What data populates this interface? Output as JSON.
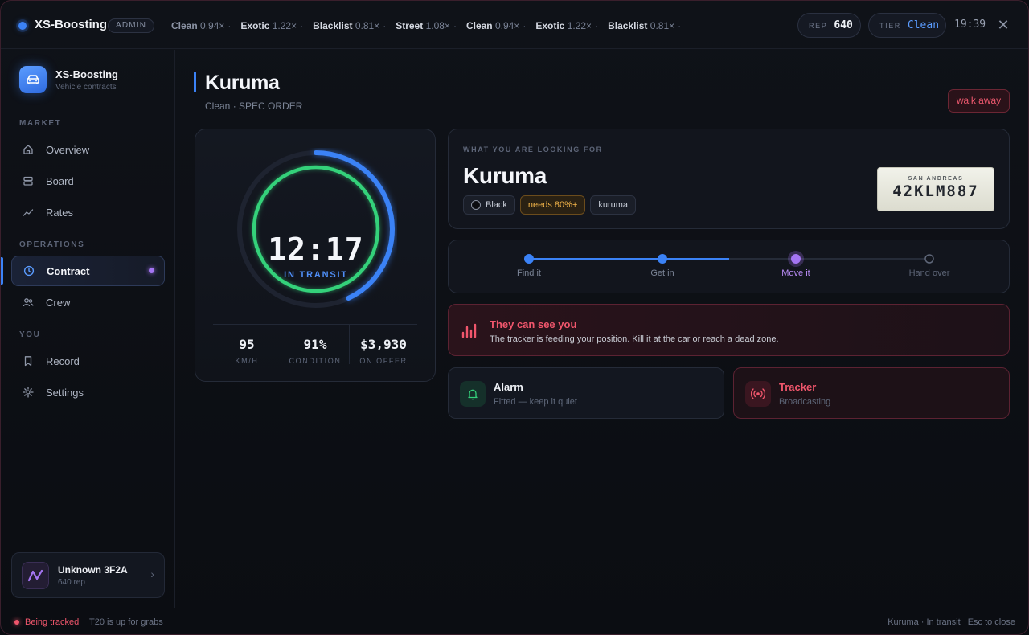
{
  "topbar": {
    "brand": "XS-Boosting",
    "badge": "ADMIN",
    "ticker": [
      {
        "name": "Clean",
        "value": "0.94×"
      },
      {
        "name": "Exotic",
        "value": "1.22×"
      },
      {
        "name": "Blacklist",
        "value": "0.81×"
      },
      {
        "name": "Street",
        "value": "1.08×"
      },
      {
        "name": "Clean",
        "value": "0.94×"
      },
      {
        "name": "Exotic",
        "value": "1.22×"
      },
      {
        "name": "Blacklist",
        "value": "0.81×"
      }
    ],
    "ticker_sep": "·",
    "rep_label": "REP",
    "rep_value": "640",
    "tier_label": "TIER",
    "tier_value": "Clean",
    "clock": "19:39",
    "close": "✕"
  },
  "sidebar": {
    "app_title": "XS-Boosting",
    "app_sub": "Vehicle contracts",
    "sections": {
      "market": "MARKET",
      "operations": "OPERATIONS",
      "you": "YOU"
    },
    "items": {
      "overview": "Overview",
      "board": "Board",
      "rates": "Rates",
      "contract": "Contract",
      "crew": "Crew",
      "record": "Record",
      "settings": "Settings"
    },
    "user": {
      "name": "Unknown 3F2A",
      "rep": "640 rep"
    }
  },
  "main": {
    "title": "Kuruma",
    "subtitle": "Clean · SPEC ORDER",
    "walk_away": "walk away",
    "timer": {
      "time": "12:17",
      "status": "IN TRANSIT",
      "outer_progress": 0.43,
      "inner_progress": 1.0
    },
    "stats": [
      {
        "value": "95",
        "label": "KM/H"
      },
      {
        "value": "91%",
        "label": "CONDITION"
      },
      {
        "value": "$3,930",
        "label": "ON OFFER"
      }
    ],
    "target": {
      "label": "WHAT YOU ARE LOOKING FOR",
      "name": "Kuruma",
      "color_chip": "Black",
      "condition_chip": "needs 80%+",
      "model_chip": "kuruma",
      "plate_state": "SAN ANDREAS",
      "plate_number": "42KLM887"
    },
    "steps": [
      {
        "label": "Find it",
        "state": "done"
      },
      {
        "label": "Get in",
        "state": "done"
      },
      {
        "label": "Move it",
        "state": "current"
      },
      {
        "label": "Hand over",
        "state": "todo"
      }
    ],
    "alert": {
      "title": "They can see you",
      "text": "The tracker is feeding your position. Kill it at the car or reach a dead zone."
    },
    "systems": {
      "alarm": {
        "name": "Alarm",
        "sub": "Fitted — keep it quiet"
      },
      "tracker": {
        "name": "Tracker",
        "sub": "Broadcasting"
      }
    }
  },
  "footer": {
    "tracked": "Being tracked",
    "message": "T20 is up for grabs",
    "status": "Kuruma · In transit",
    "hint": "Esc to close"
  },
  "colors": {
    "accent": "#3b82f6",
    "green": "#34d17a",
    "danger": "#f0566c",
    "purple": "#a475f2",
    "warn": "#f2b449"
  }
}
